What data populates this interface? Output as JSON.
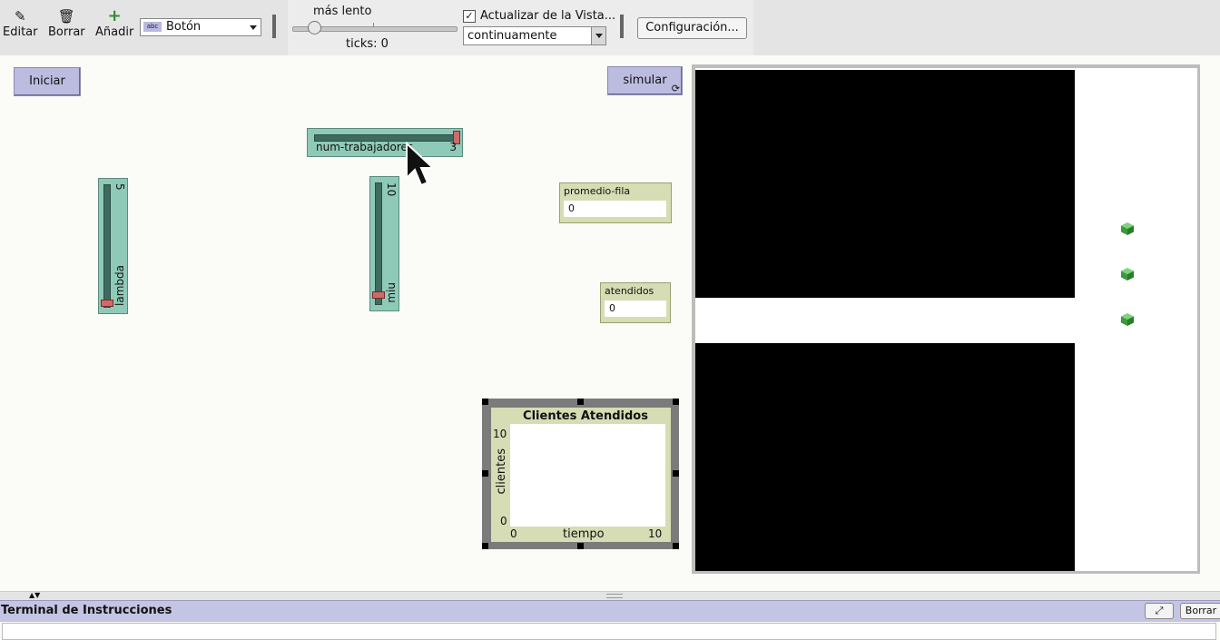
{
  "toolbar": {
    "edit_label": "Editar",
    "delete_label": "Borrar",
    "add_label": "Añadir",
    "widget_type": "Botón",
    "widget_type_icon": "abc",
    "speed_label": "más lento",
    "speed_value": 0.13,
    "ticks_label": "ticks: 0",
    "update_view_label": "Actualizar de la Vista...",
    "update_view_checked": true,
    "update_mode": "continuamente",
    "settings_label": "Configuración..."
  },
  "interface": {
    "setup_button": "Iniciar",
    "go_button": "simular",
    "sliders": [
      {
        "name": "num-trabajadores",
        "value": "3",
        "fraction": 1.0
      },
      {
        "name": "lambda",
        "value": "5",
        "fraction": 0.0
      },
      {
        "name": "miu",
        "value": "10",
        "fraction": 0.0
      }
    ],
    "monitors": [
      {
        "name": "promedio-fila",
        "value": "0"
      },
      {
        "name": "atendidos",
        "value": "0"
      }
    ],
    "plot": {
      "title": "Clientes Atendidos",
      "xlabel": "tiempo",
      "ylabel": "clientes",
      "xmin": "0",
      "xmax": "10",
      "ymin": "0",
      "ymax": "10"
    }
  },
  "view": {
    "patch_color": "#000000",
    "turtle_color": "#4caf50",
    "turtle_count": 3
  },
  "command_center": {
    "title": "Terminal de Instrucciones",
    "clear_label": "Borrar"
  },
  "chart_data": {
    "type": "line",
    "title": "Clientes Atendidos",
    "xlabel": "tiempo",
    "ylabel": "clientes",
    "xlim": [
      0,
      10
    ],
    "ylim": [
      0,
      10
    ],
    "series": []
  }
}
